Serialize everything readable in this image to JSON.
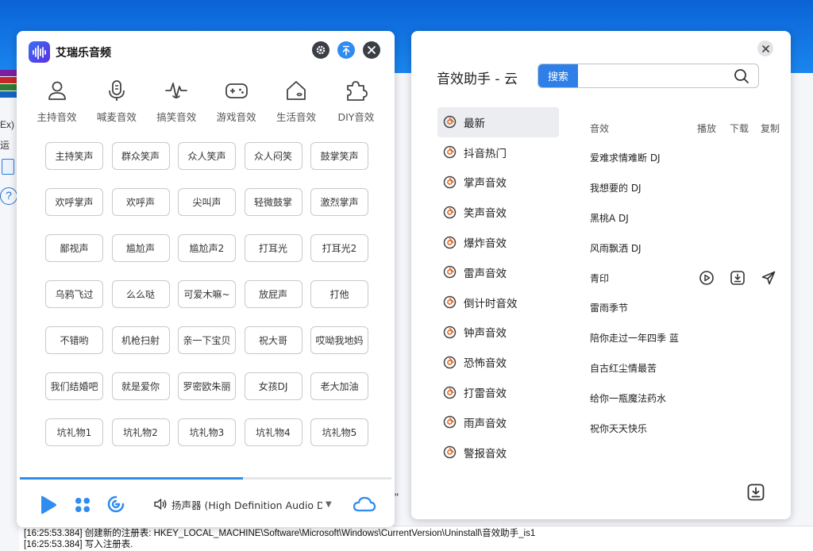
{
  "desktop": {
    "fragments": [
      "Ex)",
      "运"
    ],
    "help_glyph": "?",
    "quote": "\"",
    "log_lines": [
      "[16:25:53.384]  创建新的注册表: HKEY_LOCAL_MACHINE\\Software\\Microsoft\\Windows\\CurrentVersion\\Uninstall\\音效助手_is1",
      "[16:25:53.384]  写入注册表."
    ]
  },
  "left_app": {
    "title": "艾瑞乐音频",
    "logo_icon": "soundwave-logo-icon",
    "titlebar_buttons": [
      {
        "name": "settings",
        "icon": "gear-icon",
        "color": "#3b3f45"
      },
      {
        "name": "pin",
        "icon": "pin-up-icon",
        "color": "#2f8cf0"
      },
      {
        "name": "close",
        "icon": "close-icon",
        "color": "#3b3f45"
      }
    ],
    "categories": [
      {
        "label": "主持音效",
        "icon": "person-icon"
      },
      {
        "label": "喊麦音效",
        "icon": "microphone-icon"
      },
      {
        "label": "搞笑音效",
        "icon": "laugh-wave-icon"
      },
      {
        "label": "游戏音效",
        "icon": "gamepad-icon"
      },
      {
        "label": "生活音效",
        "icon": "house-icon"
      },
      {
        "label": "DIY音效",
        "icon": "puzzle-icon"
      }
    ],
    "sound_buttons": [
      "主持笑声",
      "群众笑声",
      "众人笑声",
      "众人闷笑",
      "鼓掌笑声",
      "欢呼掌声",
      "欢呼声",
      "尖叫声",
      "轻微鼓掌",
      "激烈掌声",
      "鄙视声",
      "尴尬声",
      "尴尬声2",
      "打耳光",
      "打耳光2",
      "乌鸦飞过",
      "么么哒",
      "可爱木嘛~",
      "放屁声",
      "打他",
      "不错哟",
      "机枪扫射",
      "亲一下宝贝",
      "祝大哥",
      "哎呦我地妈",
      "我们结婚吧",
      "就是爱你",
      "罗密欧朱丽",
      "女孩DJ",
      "老大加油",
      "坑礼物1",
      "坑礼物2",
      "坑礼物3",
      "坑礼物4",
      "坑礼物5"
    ],
    "progress": 0.6,
    "bottom": {
      "play_icon": "play-icon",
      "apps_icon": "apps-grid-icon",
      "swirl_icon": "swirl-icon",
      "device_label": "扬声器 (High Definition Audio Devi",
      "volume_icon": "speaker-icon",
      "cloud_icon": "cloud-icon"
    },
    "colors": {
      "accent": "#2f8cf0"
    }
  },
  "right_app": {
    "title": "音效助手 - 云",
    "search": {
      "tag": "搜索",
      "value": "",
      "placeholder": ""
    },
    "categories": [
      {
        "label": "最新",
        "active": true
      },
      {
        "label": "抖音热门"
      },
      {
        "label": "掌声音效"
      },
      {
        "label": "笑声音效"
      },
      {
        "label": "爆炸音效"
      },
      {
        "label": "雷声音效"
      },
      {
        "label": "倒计时音效"
      },
      {
        "label": "钟声音效"
      },
      {
        "label": "恐怖音效"
      },
      {
        "label": "打雷音效"
      },
      {
        "label": "雨声音效"
      },
      {
        "label": "警报音效"
      }
    ],
    "list_header": {
      "name": "音效",
      "play": "播放",
      "download": "下载",
      "copy": "复制"
    },
    "songs": [
      "爱难求情难断 DJ",
      "我想要的 DJ",
      "黑桃A DJ",
      "风雨飘洒 DJ",
      "青印",
      "雷雨季节",
      "陪你走过一年四季 蓝",
      "自古红尘情最苦",
      "给你一瓶魔法药水",
      "祝你天天快乐"
    ],
    "hover_row_index": 4,
    "row_action_icons": [
      "play-circle-icon",
      "download-icon",
      "send-icon"
    ],
    "colors": {
      "accent": "#2f7fe8",
      "category_icon": "#e0692b"
    }
  }
}
